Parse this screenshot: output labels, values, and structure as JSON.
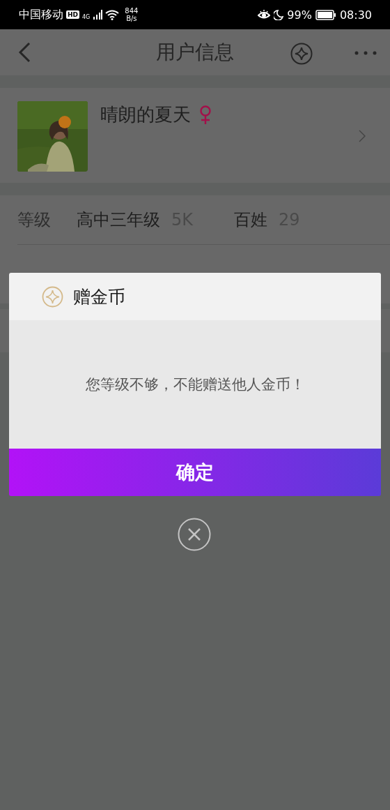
{
  "status_bar": {
    "carrier": "中国移动",
    "hd": "HD",
    "network": "4G",
    "speed_value": "844",
    "speed_unit": "B/s",
    "battery": "99%",
    "time": "08:30"
  },
  "nav": {
    "title": "用户信息"
  },
  "profile": {
    "name": "晴朗的夏天"
  },
  "info_rows": [
    {
      "label": "等级",
      "items": [
        {
          "name": "高中三年级",
          "value": "5K"
        },
        {
          "name": "百姓",
          "value": "29"
        }
      ]
    }
  ],
  "dialog": {
    "title": "赠金币",
    "message": "您等级不够，不能赠送他人金币！",
    "confirm": "确定"
  }
}
